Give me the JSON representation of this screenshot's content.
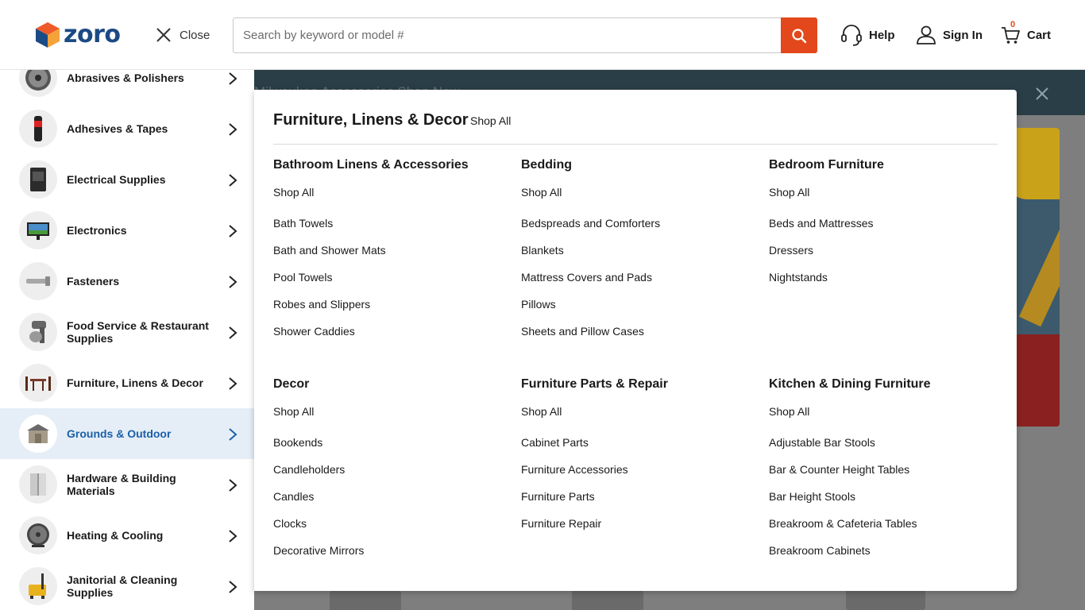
{
  "header": {
    "logo_text": "zoro",
    "close_label": "Close",
    "search_placeholder": "Search by keyword or model #",
    "search_value": "",
    "help_label": "Help",
    "signin_label": "Sign In",
    "cart_label": "Cart",
    "cart_count": "0"
  },
  "background": {
    "promo_text": "Milwaukee Accessories Shop Now"
  },
  "sidebar": {
    "items": [
      {
        "label": "Abrasives & Polishers",
        "icon": "abrasive-disc-icon"
      },
      {
        "label": "Adhesives & Tapes",
        "icon": "adhesive-tube-icon"
      },
      {
        "label": "Electrical Supplies",
        "icon": "electrical-box-icon"
      },
      {
        "label": "Electronics",
        "icon": "monitor-icon"
      },
      {
        "label": "Fasteners",
        "icon": "bolt-icon"
      },
      {
        "label": "Food Service & Restaurant Supplies",
        "icon": "mixer-icon"
      },
      {
        "label": "Furniture, Linens & Decor",
        "icon": "table-chairs-icon"
      },
      {
        "label": "Grounds & Outdoor",
        "icon": "shed-icon"
      },
      {
        "label": "Hardware & Building Materials",
        "icon": "hinge-icon"
      },
      {
        "label": "Heating & Cooling",
        "icon": "fan-icon"
      },
      {
        "label": "Janitorial & Cleaning Supplies",
        "icon": "mop-bucket-icon"
      }
    ],
    "active_index": 7
  },
  "menu": {
    "title": "Furniture, Linens & Decor",
    "shop_all": "Shop All",
    "sections": [
      {
        "title": "Bathroom Linens & Accessories",
        "shop_all": "Shop All",
        "items": [
          "Bath Towels",
          "Bath and Shower Mats",
          "Pool Towels",
          "Robes and Slippers",
          "Shower Caddies"
        ]
      },
      {
        "title": "Bedding",
        "shop_all": "Shop All",
        "items": [
          "Bedspreads and Comforters",
          "Blankets",
          "Mattress Covers and Pads",
          "Pillows",
          "Sheets and Pillow Cases"
        ]
      },
      {
        "title": "Bedroom Furniture",
        "shop_all": "Shop All",
        "items": [
          "Beds and Mattresses",
          "Dressers",
          "Nightstands"
        ]
      },
      {
        "title": "Decor",
        "shop_all": "Shop All",
        "items": [
          "Bookends",
          "Candleholders",
          "Candles",
          "Clocks",
          "Decorative Mirrors"
        ]
      },
      {
        "title": "Furniture Parts & Repair",
        "shop_all": "Shop All",
        "items": [
          "Cabinet Parts",
          "Furniture Accessories",
          "Furniture Parts",
          "Furniture Repair"
        ]
      },
      {
        "title": "Kitchen & Dining Furniture",
        "shop_all": "Shop All",
        "items": [
          "Adjustable Bar Stools",
          "Bar & Counter Height Tables",
          "Bar Height Stools",
          "Breakroom & Cafeteria Tables",
          "Breakroom Cabinets"
        ]
      }
    ]
  },
  "colors": {
    "brand_blue": "#1b4a84",
    "accent_orange": "#e2481b",
    "active_bg": "#e5eef6",
    "active_text": "#1b5fa8"
  }
}
